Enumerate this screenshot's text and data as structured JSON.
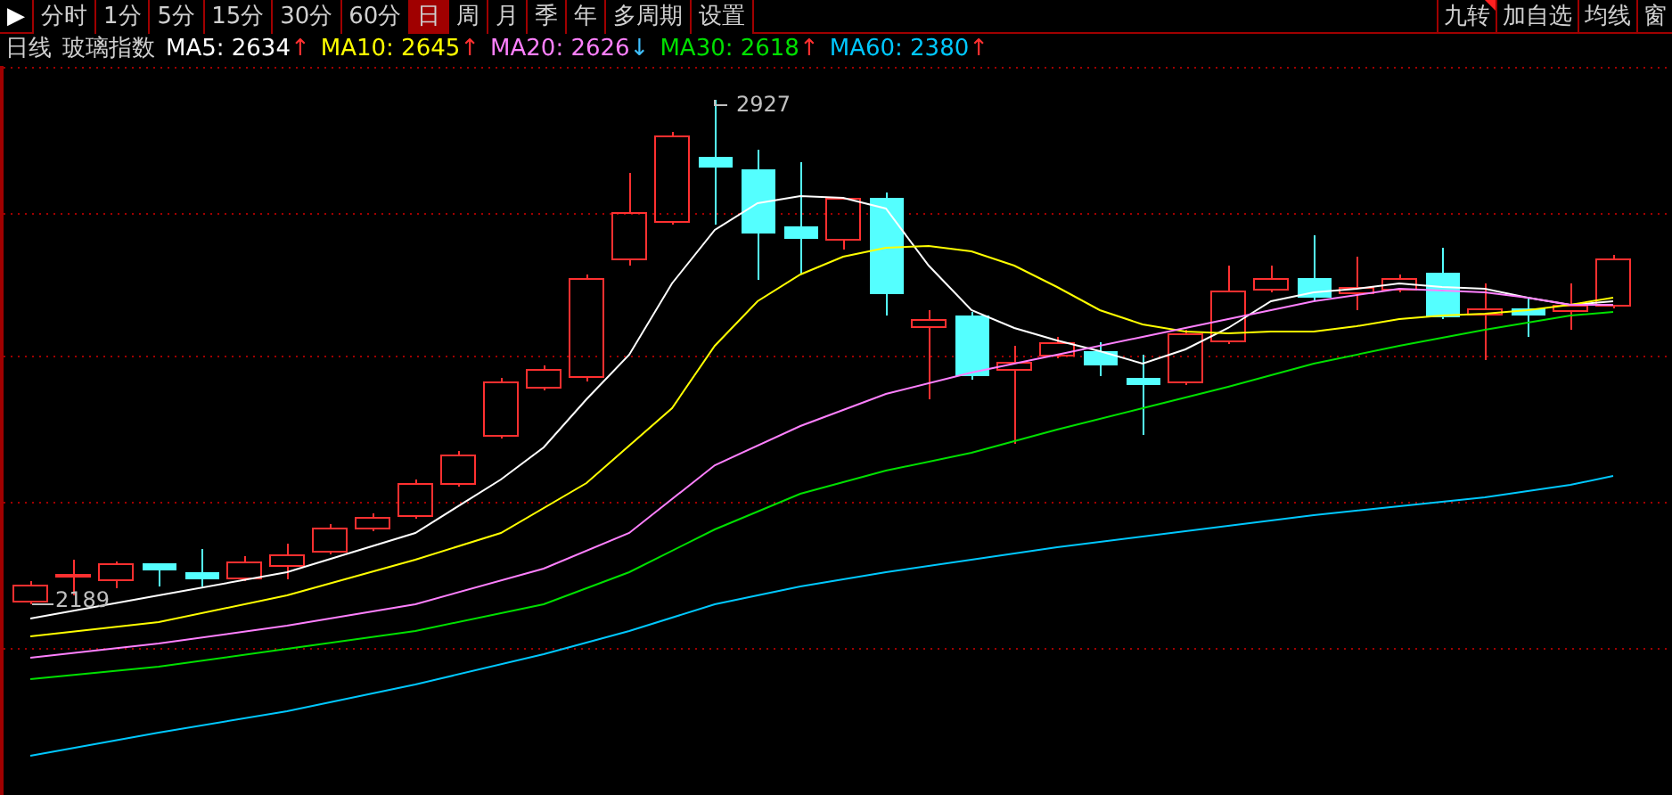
{
  "toolbar": {
    "collapse_icon": "▶",
    "periods": [
      {
        "label": "分时",
        "selected": false
      },
      {
        "label": "1分",
        "selected": false
      },
      {
        "label": "5分",
        "selected": false
      },
      {
        "label": "15分",
        "selected": false
      },
      {
        "label": "30分",
        "selected": false
      },
      {
        "label": "60分",
        "selected": false
      },
      {
        "label": "日",
        "selected": true
      },
      {
        "label": "周",
        "selected": false
      },
      {
        "label": "月",
        "selected": false
      },
      {
        "label": "季",
        "selected": false
      },
      {
        "label": "年",
        "selected": false
      },
      {
        "label": "多周期",
        "selected": false
      },
      {
        "label": "设置",
        "selected": false
      }
    ],
    "right_buttons": [
      {
        "label": "九转",
        "flagged": true
      },
      {
        "label": "加自选",
        "flagged": false
      },
      {
        "label": "均线",
        "flagged": false
      },
      {
        "label": "窗",
        "flagged": false
      }
    ]
  },
  "legend": {
    "period": "日线",
    "name": "玻璃指数",
    "averages": [
      {
        "label": "MA5: 2634",
        "trend": {
          "text": "↑",
          "color": "#ff3030"
        },
        "color": "#ffffff"
      },
      {
        "label": "MA10: 2645",
        "trend": {
          "text": "↑",
          "color": "#ff3030"
        },
        "color": "#ffff00"
      },
      {
        "label": "MA20: 2626",
        "trend": {
          "text": "↓",
          "color": "#40c0ff"
        },
        "color": "#ff80ff"
      },
      {
        "label": "MA30: 2618",
        "trend": {
          "text": "↑",
          "color": "#ff3030"
        },
        "color": "#00e000"
      },
      {
        "label": "MA60: 2380",
        "trend": {
          "text": "↑",
          "color": "#ff3030"
        },
        "color": "#00c8ff"
      }
    ]
  },
  "chart": {
    "high_label": "2927",
    "low_label": "2189"
  }
}
